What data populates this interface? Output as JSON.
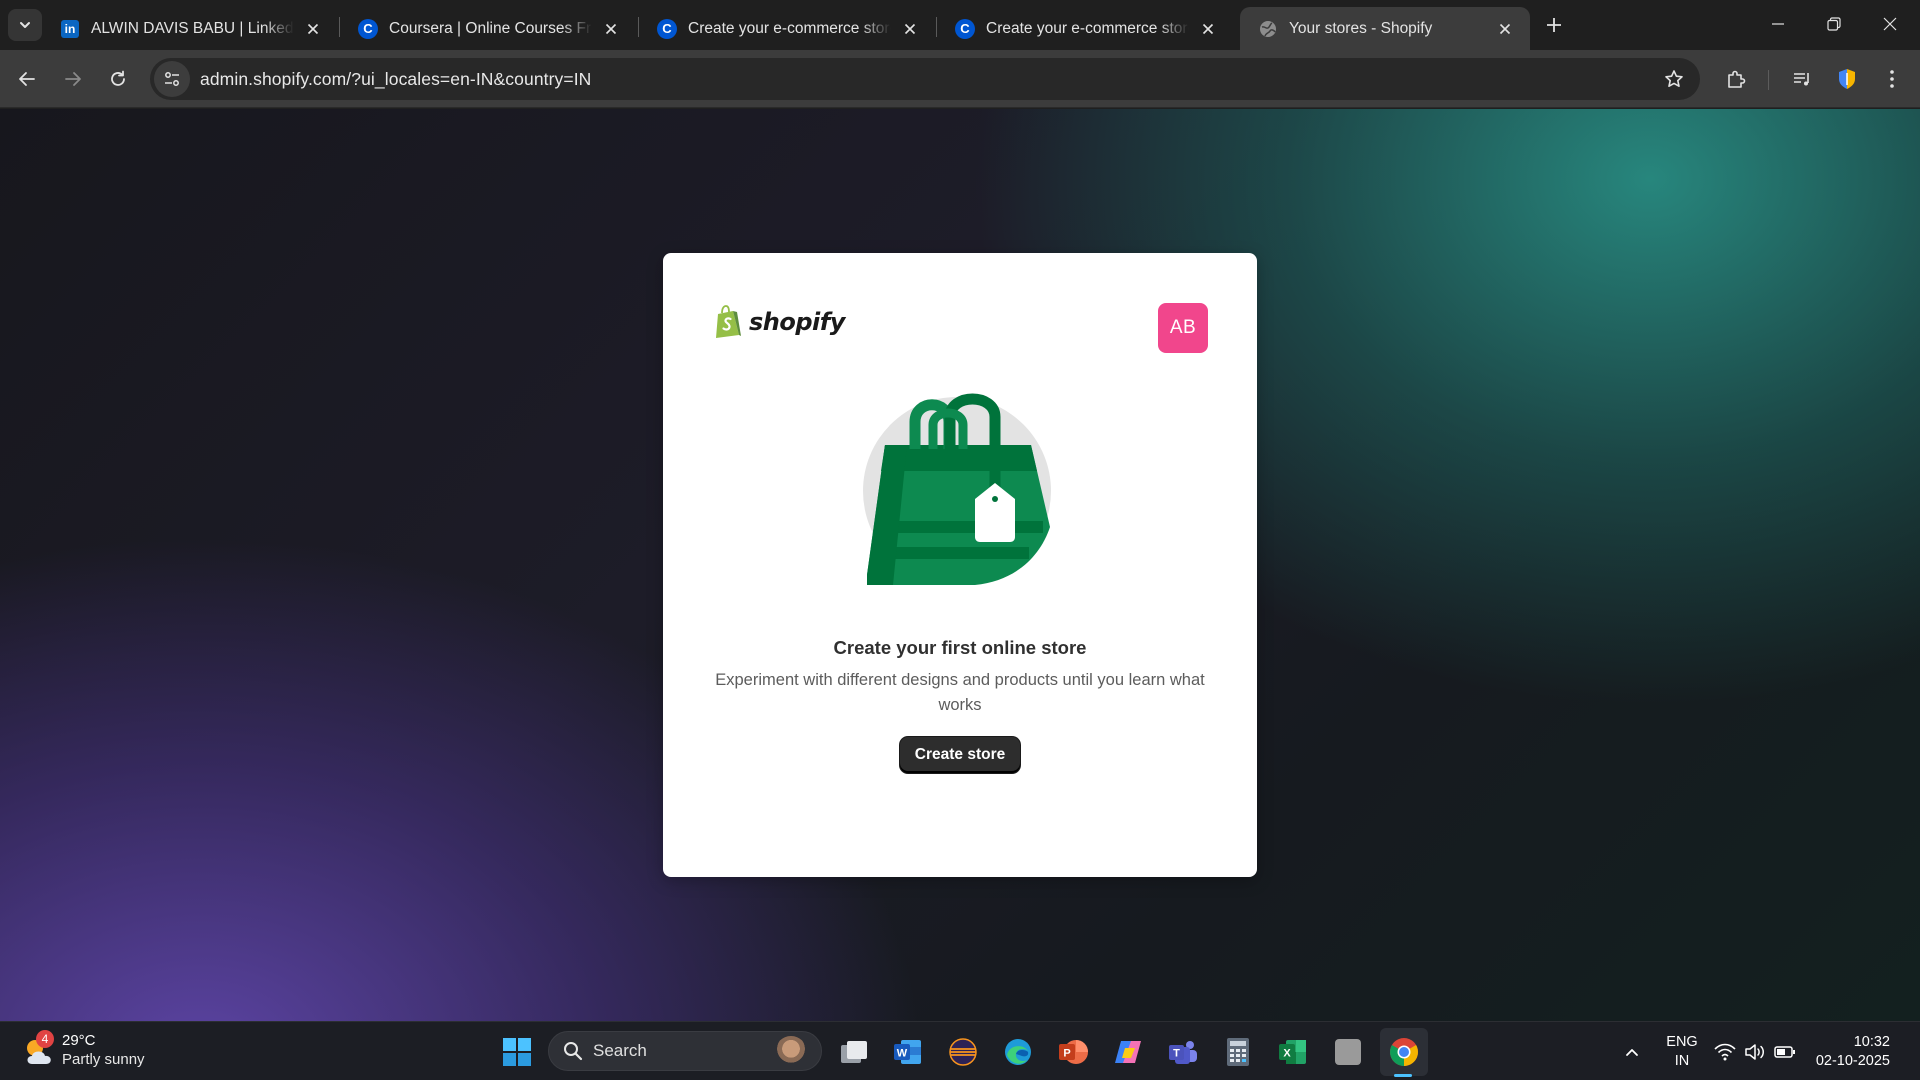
{
  "browser": {
    "tabs": [
      {
        "title": "ALWIN DAVIS BABU | LinkedIn",
        "favicon": "linkedin-icon",
        "active": false
      },
      {
        "title": "Coursera | Online Courses From",
        "favicon": "coursera-icon",
        "active": false
      },
      {
        "title": "Create your e-commerce store w",
        "favicon": "coursera-icon",
        "active": false
      },
      {
        "title": "Create your e-commerce store w",
        "favicon": "coursera-icon",
        "active": false
      },
      {
        "title": "Your stores - Shopify",
        "favicon": "globe-icon",
        "active": true
      }
    ],
    "url": "admin.shopify.com/?ui_locales=en-IN&country=IN"
  },
  "page": {
    "brand": "shopify",
    "avatar_initials": "AB",
    "heading": "Create your first online store",
    "description": "Experiment with different designs and products until you learn what works",
    "create_button": "Create store",
    "colors": {
      "avatar": "#f1468c",
      "bag_dark": "#00733b",
      "bag_mid": "#0d8a50",
      "button": "#2d2d2d"
    }
  },
  "taskbar": {
    "weather": {
      "badge": "4",
      "temp": "29°C",
      "condition": "Partly sunny"
    },
    "search_label": "Search",
    "apps": [
      "windows-start-icon",
      "task-view-icon",
      "word-icon",
      "eclipse-icon",
      "edge-icon",
      "powerpoint-icon",
      "copilot-icon",
      "teams-icon",
      "calculator-icon",
      "excel-icon",
      "blank-app-icon",
      "chrome-icon"
    ],
    "tray": {
      "lang_top": "ENG",
      "lang_bottom": "IN",
      "time": "10:32",
      "date": "02-10-2025"
    }
  }
}
